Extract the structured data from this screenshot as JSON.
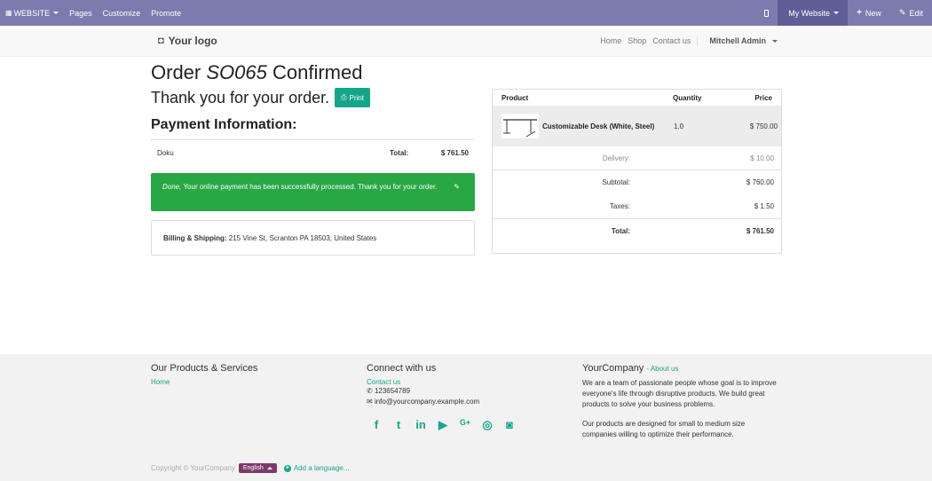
{
  "adminbar": {
    "website_label": "WEBSITE",
    "pages_label": "Pages",
    "customize_label": "Customize",
    "promote_label": "Promote",
    "my_website_label": "My Website",
    "new_label": "New",
    "edit_label": "Edit"
  },
  "header": {
    "logo_text": "Your logo",
    "nav": [
      "Home",
      "Shop",
      "Contact us"
    ],
    "user": "Mitchell Admin"
  },
  "order": {
    "title_prefix": "Order",
    "order_number": "SO065",
    "title_suffix": "Confirmed",
    "thanks": "Thank you for your order.",
    "print_label": "Print",
    "payment_heading": "Payment Information:",
    "acquirer": "Doku",
    "total_label": "Total:",
    "total_value": "$ 761.50",
    "alert_done": "Done,",
    "alert_message": "Your online payment has been successfully processed. Thank you for your order.",
    "billing_label": "Billing & Shipping:",
    "billing_address": "215 Vine St, Scranton PA 18503, United States"
  },
  "table": {
    "headers": {
      "product": "Product",
      "quantity": "Quantity",
      "price": "Price"
    },
    "line": {
      "product": "Customizable Desk (White, Steel)",
      "quantity": "1.0",
      "price": "$ 750.00"
    },
    "delivery_label": "Delivery:",
    "delivery_value": "$ 10.00",
    "subtotal_label": "Subtotal:",
    "subtotal_value": "$ 760.00",
    "taxes_label": "Taxes:",
    "taxes_value": "$ 1.50",
    "total_label": "Total:",
    "total_value": "$ 761.50"
  },
  "footer": {
    "col1_heading": "Our Products & Services",
    "col1_link": "Home",
    "col2_heading": "Connect with us",
    "col2_link": "Contact us",
    "phone": "123654789",
    "email": "info@yourcompany.example.com",
    "col3_heading": "YourCompany",
    "col3_sub": "- About us",
    "col3_text1": "We are a team of passionate people whose goal is to improve everyone's life through disruptive products. We build great products to solve your business problems.",
    "col3_text2": "Our products are designed for small to medium size companies willing to optimize their performance.",
    "social_icons": [
      "facebook-icon",
      "twitter-icon",
      "linkedin-icon",
      "youtube-icon",
      "google-plus-icon",
      "github-icon",
      "instagram-icon"
    ],
    "copyright": "Copyright © YourCompany",
    "language": "English",
    "add_language": "Add a language..."
  },
  "colors": {
    "adminbar": "#7c7bad",
    "accent": "#17a589",
    "success": "#28a745",
    "language_button": "#7c3a6b"
  }
}
